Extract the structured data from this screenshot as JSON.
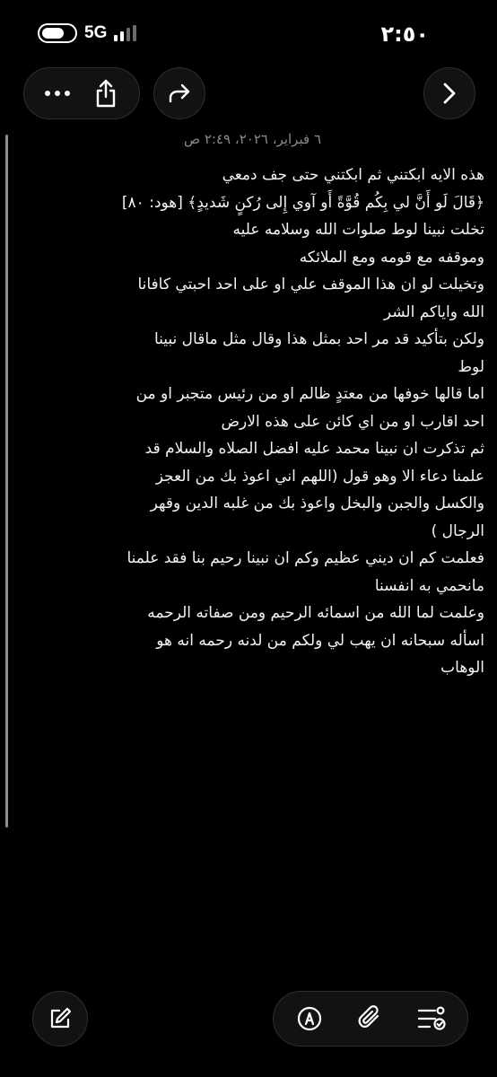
{
  "status_bar": {
    "network": "5G",
    "time": "٢:٥٠",
    "icons": {
      "toggle": "toggle-pill-icon",
      "signal": "signal-bars-icon"
    },
    "colors": {
      "signal_active": "#ffffff",
      "signal_inactive": "#6b6b6b"
    }
  },
  "toolbar": {
    "more_icon": "ellipsis-icon",
    "share_icon": "share-icon",
    "redo_icon": "redo-icon",
    "forward_icon": "chevron-right-icon"
  },
  "note": {
    "date": "٦ فبراير، ٢٠٢٦، ٢:٤٩ ص",
    "lines": [
      "هذه الايه ابكتني ثم ابكتني حتى جف دمعي",
      "﴿قَالَ لَو أَنَّ لي بِكُم قُوَّةً أَو آوي إِلى رُكنٍ شَديدٍ﴾ [هود: ٨٠]",
      "تخلت نبينا لوط صلوات الله وسلامه عليه",
      "وموقفه مع قومه ومع الملائكه",
      "وتخيلت لو ان هذا الموقف علي او على احد احبتي كافانا",
      "الله واياكم الشر",
      "ولكن بتأكيد قد مر احد بمثل هذا وقال مثل ماقال نبينا",
      "لوط",
      "اما قالها خوفها من معتدٍ ظالم او من رئيس متجبر او من",
      "احد اقارب او من اي كائن على هذه الارض",
      "ثم تذكرت ان نبينا محمد عليه افضل الصلاه والسلام قد",
      "علمنا دعاء الا وهو قول (اللهم اني اعوذ بك من العجز",
      "والكسل والجبن والبخل واعوذ بك من غلبه الدين وقهر",
      "الرجال )",
      "فعلمت كم ان ديني عظيم وكم ان نبينا رحيم بنا فقد علمنا",
      "مانحمي به انفسنا",
      "وعلمت لما الله من اسمائه الرحيم ومن صفاته الرحمه",
      "اسأله سبحانه ان يهب لي ولكم من لدنه رحمه انه هو",
      "الوهاب"
    ]
  },
  "bottom_toolbar": {
    "compose_icon": "compose-icon",
    "markup_icon": "markup-pen-icon",
    "attach_icon": "paperclip-icon",
    "checklist_icon": "checklist-icon"
  }
}
